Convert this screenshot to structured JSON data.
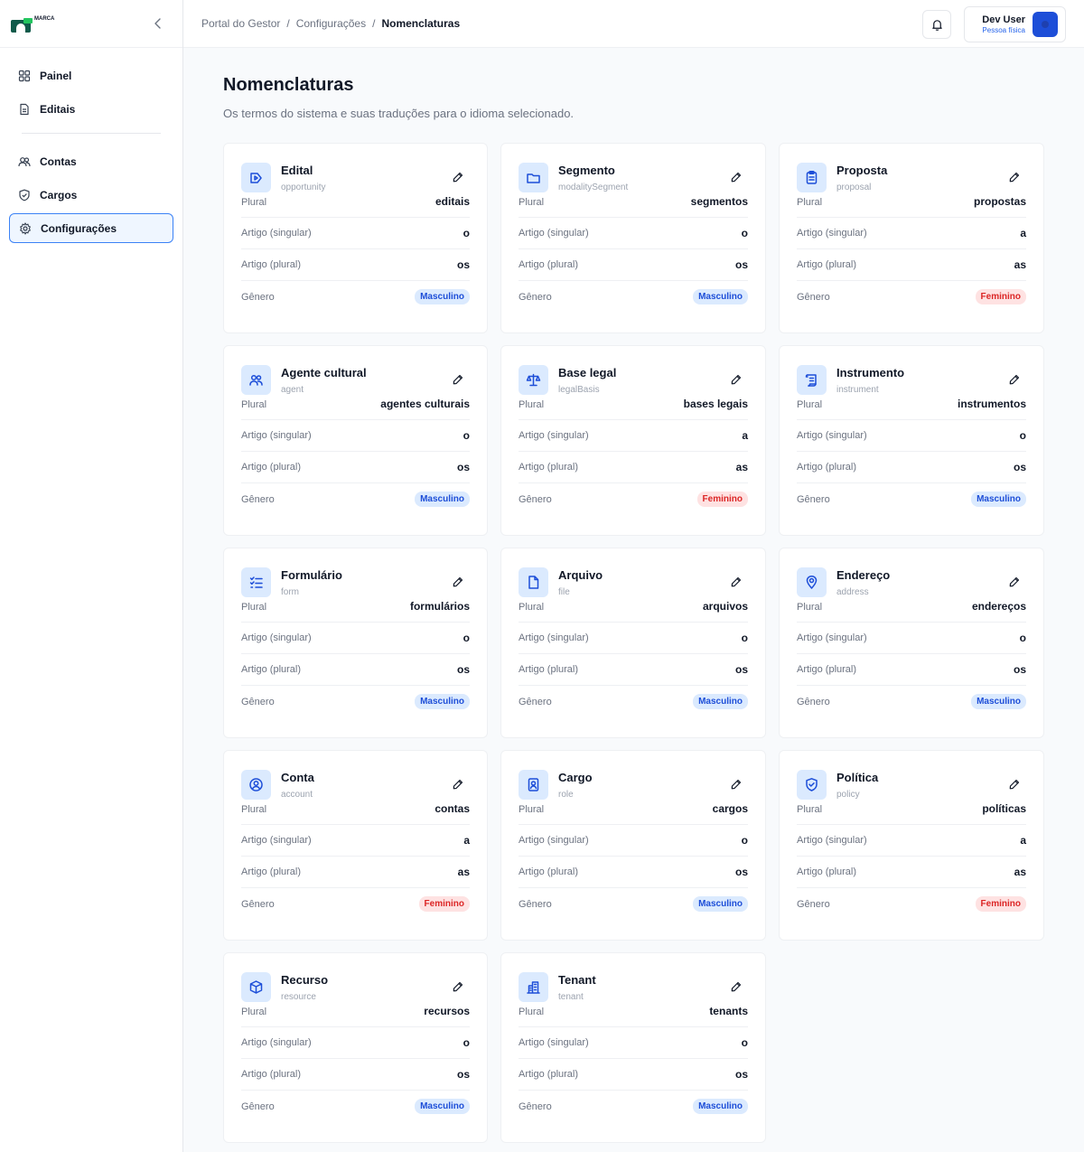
{
  "brand": {
    "name": "MARCA"
  },
  "sidebar": {
    "items": [
      {
        "label": "Painel",
        "icon": "grid-icon"
      },
      {
        "label": "Editais",
        "icon": "document-icon"
      },
      {
        "label": "Contas",
        "icon": "users-icon"
      },
      {
        "label": "Cargos",
        "icon": "shield-icon"
      },
      {
        "label": "Configurações",
        "icon": "gear-icon",
        "active": true
      }
    ]
  },
  "breadcrumb": [
    "Portal do Gestor",
    "Configurações",
    "Nomenclaturas"
  ],
  "user": {
    "name": "Dev User",
    "role": "Pessoa física"
  },
  "page": {
    "title": "Nomenclaturas",
    "subtitle": "Os termos do sistema e suas traduções para o idioma selecionado."
  },
  "labels": {
    "plural": "Plural",
    "article_singular": "Artigo (singular)",
    "article_plural": "Artigo (plural)",
    "gender": "Gênero"
  },
  "cards": [
    {
      "name": "Edital",
      "key": "opportunity",
      "plural": "editais",
      "art_s": "o",
      "art_p": "os",
      "gender": "Masculino",
      "icon": "opportunity-icon"
    },
    {
      "name": "Segmento",
      "key": "modalitySegment",
      "plural": "segmentos",
      "art_s": "o",
      "art_p": "os",
      "gender": "Masculino",
      "icon": "folder-icon"
    },
    {
      "name": "Proposta",
      "key": "proposal",
      "plural": "propostas",
      "art_s": "a",
      "art_p": "as",
      "gender": "Feminino",
      "icon": "clipboard-icon"
    },
    {
      "name": "Agente cultural",
      "key": "agent",
      "plural": "agentes culturais",
      "art_s": "o",
      "art_p": "os",
      "gender": "Masculino",
      "icon": "users-icon"
    },
    {
      "name": "Base legal",
      "key": "legalBasis",
      "plural": "bases legais",
      "art_s": "a",
      "art_p": "as",
      "gender": "Feminino",
      "icon": "scale-icon"
    },
    {
      "name": "Instrumento",
      "key": "instrument",
      "plural": "instrumentos",
      "art_s": "o",
      "art_p": "os",
      "gender": "Masculino",
      "icon": "scroll-icon"
    },
    {
      "name": "Formulário",
      "key": "form",
      "plural": "formulários",
      "art_s": "o",
      "art_p": "os",
      "gender": "Masculino",
      "icon": "checklist-icon"
    },
    {
      "name": "Arquivo",
      "key": "file",
      "plural": "arquivos",
      "art_s": "o",
      "art_p": "os",
      "gender": "Masculino",
      "icon": "file-icon"
    },
    {
      "name": "Endereço",
      "key": "address",
      "plural": "endereços",
      "art_s": "o",
      "art_p": "os",
      "gender": "Masculino",
      "icon": "map-pin-icon"
    },
    {
      "name": "Conta",
      "key": "account",
      "plural": "contas",
      "art_s": "a",
      "art_p": "as",
      "gender": "Feminino",
      "icon": "user-circle-icon"
    },
    {
      "name": "Cargo",
      "key": "role",
      "plural": "cargos",
      "art_s": "o",
      "art_p": "os",
      "gender": "Masculino",
      "icon": "badge-icon"
    },
    {
      "name": "Política",
      "key": "policy",
      "plural": "políticas",
      "art_s": "a",
      "art_p": "as",
      "gender": "Feminino",
      "icon": "shield-check-icon"
    },
    {
      "name": "Recurso",
      "key": "resource",
      "plural": "recursos",
      "art_s": "o",
      "art_p": "os",
      "gender": "Masculino",
      "icon": "box-icon"
    },
    {
      "name": "Tenant",
      "key": "tenant",
      "plural": "tenants",
      "art_s": "o",
      "art_p": "os",
      "gender": "Masculino",
      "icon": "building-icon"
    }
  ],
  "colors": {
    "accent": "#2563eb",
    "male_bg": "#dbeafe",
    "male_fg": "#1d4ed8",
    "female_bg": "#fee2e2",
    "female_fg": "#dc2626"
  }
}
